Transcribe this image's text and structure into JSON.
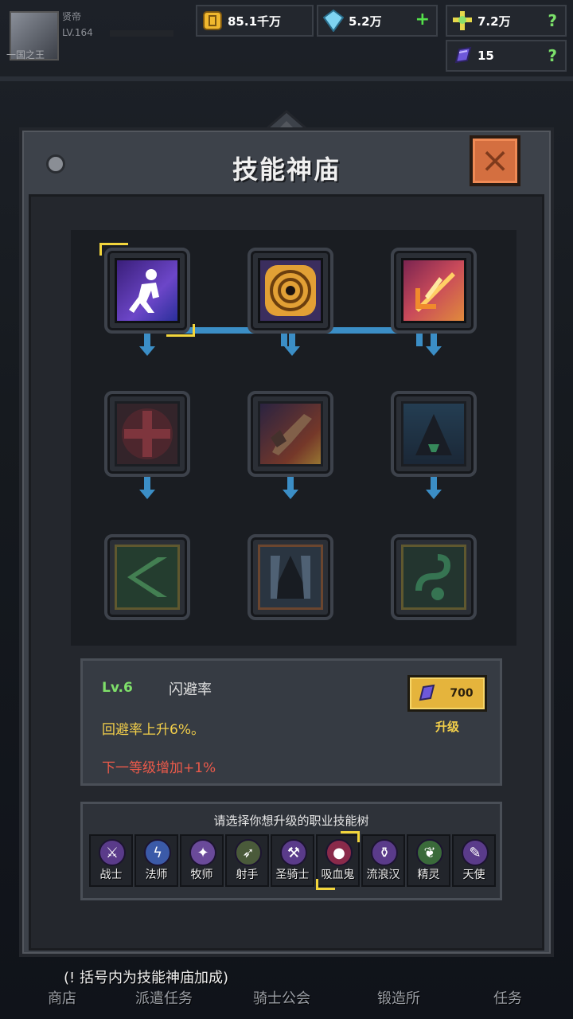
{
  "player": {
    "name": "贤帝",
    "level": "LV.164",
    "title": "一国之王"
  },
  "resources": {
    "gold": {
      "value": "85.1千万",
      "icon": "gold-coin-icon"
    },
    "diamond": {
      "value": "5.2万",
      "icon": "diamond-icon",
      "action": "+"
    },
    "cross": {
      "value": "7.2万",
      "icon": "holy-cross-icon",
      "help": "?"
    },
    "crystal": {
      "value": "15",
      "icon": "crystal-icon",
      "help": "?"
    }
  },
  "panel": {
    "title": "技能神庙",
    "close_icon": "×"
  },
  "tree": {
    "row1": [
      "dodge-skill-icon",
      "target-skill-icon",
      "slash-skill-icon"
    ],
    "row2": [
      "heal-cross-skill-icon",
      "hammer-skill-icon",
      "shadow-cloak-skill-icon"
    ],
    "row3": [
      "wind-skill-icon",
      "dark-hood-skill-icon",
      "serpent-skill-icon"
    ]
  },
  "info": {
    "level": "Lv.6",
    "name": "闪避率",
    "desc": "回避率上升6%。",
    "next": "下一等级增加+1%",
    "upgrade_cost": "700",
    "upgrade_label": "升级"
  },
  "classes": {
    "prompt": "请选择你想升级的职业技能树",
    "items": [
      {
        "label": "战士",
        "icon": "sword-icon"
      },
      {
        "label": "法师",
        "icon": "lightning-icon"
      },
      {
        "label": "牧师",
        "icon": "staff-icon"
      },
      {
        "label": "射手",
        "icon": "bow-icon"
      },
      {
        "label": "圣骑士",
        "icon": "axe-icon"
      },
      {
        "label": "吸血鬼",
        "icon": "blood-icon"
      },
      {
        "label": "流浪汉",
        "icon": "bottle-icon"
      },
      {
        "label": "精灵",
        "icon": "leaf-icon"
      },
      {
        "label": "天使",
        "icon": "feather-icon"
      }
    ]
  },
  "footer": {
    "note": "(! 括号内为技能神庙加成)",
    "nav": [
      "商店",
      "派遣任务",
      "骑士公会",
      "锻造所",
      "任务"
    ]
  }
}
